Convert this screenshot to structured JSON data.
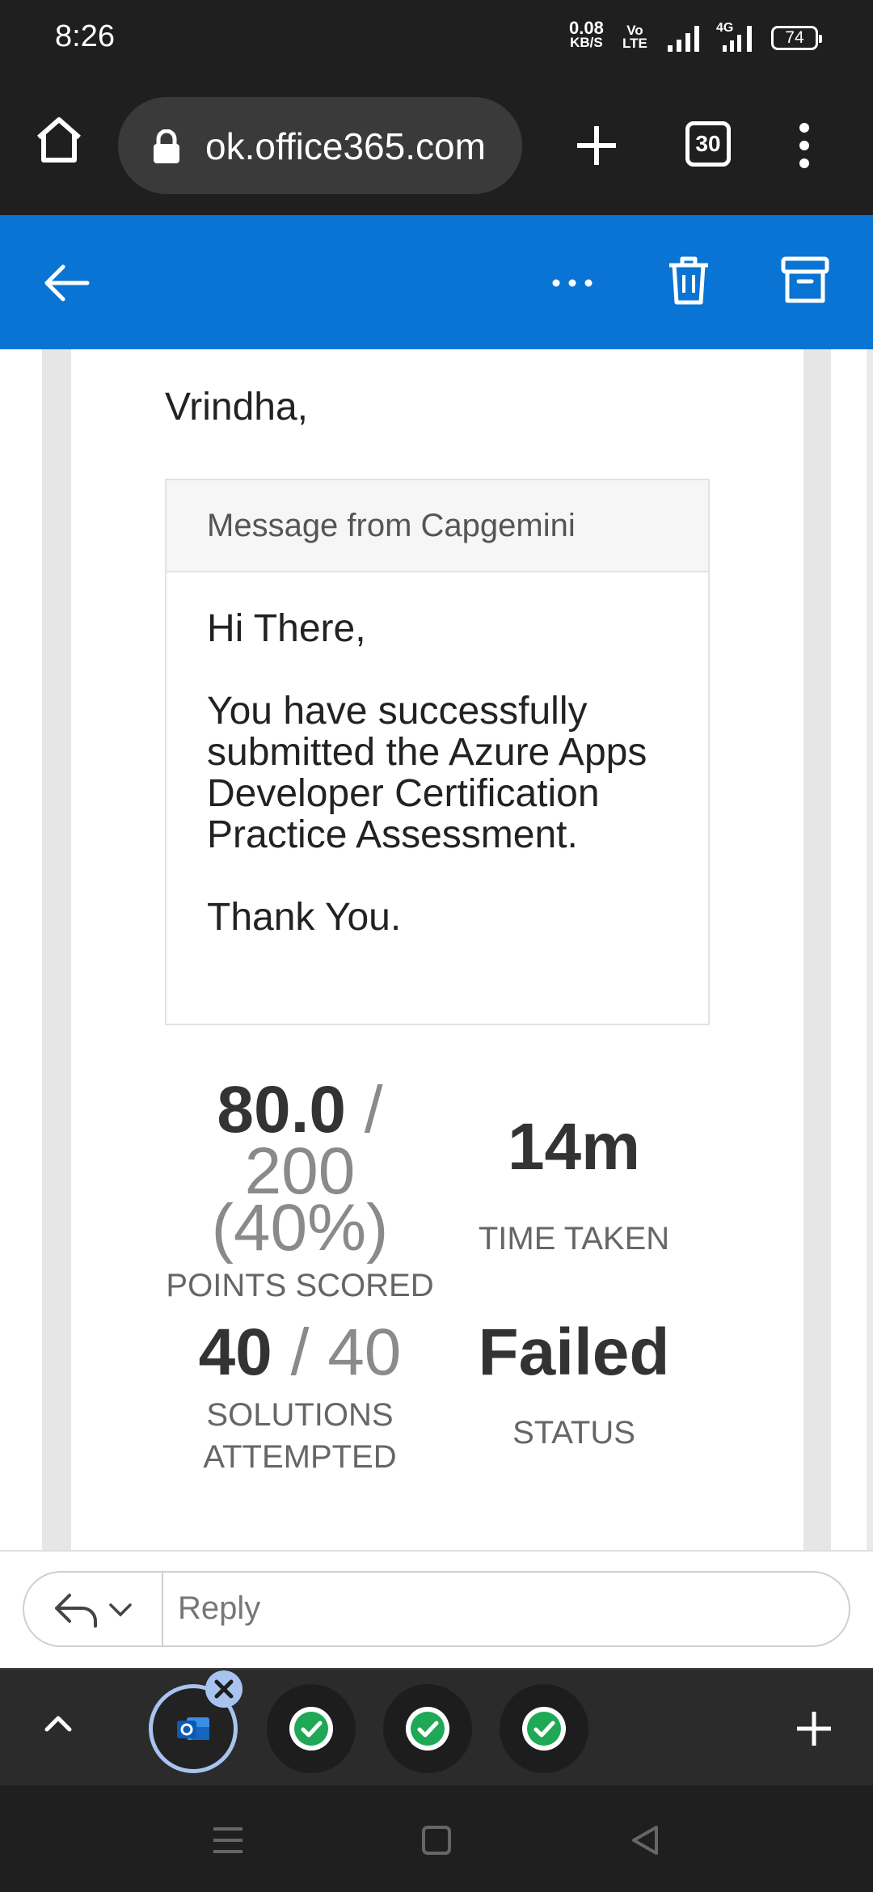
{
  "status_bar": {
    "time": "8:26",
    "net_speed_value": "0.08",
    "net_speed_unit": "KB/S",
    "volte_top": "Vo",
    "volte_bottom": "LTE",
    "network_type": "4G",
    "battery": "74"
  },
  "browser": {
    "url": "ok.office365.com",
    "tab_count": "30",
    "icons": [
      "home-icon",
      "lock-icon",
      "plus-icon",
      "tabs-icon",
      "kebab-menu-icon"
    ]
  },
  "app_bar": {
    "color": "#0a74d4",
    "icons": [
      "back-arrow-icon",
      "more-horizontal-icon",
      "trash-icon",
      "archive-icon"
    ]
  },
  "email": {
    "greeting": "Vrindha,",
    "message_header": "Message from Capgemini",
    "body": {
      "line1": "Hi There,",
      "line2": "You have successfully submitted the Azure Apps Developer Certification Practice Assessment.",
      "line3": "Thank You."
    },
    "stats": {
      "points_scored": "80.0",
      "points_separator": "/",
      "points_total": "200",
      "points_percent": "(40%)",
      "points_label": "POINTS SCORED",
      "time_taken": "14m",
      "time_label": "TIME TAKEN",
      "solutions_attempted": "40",
      "solutions_separator": "/",
      "solutions_total": "40",
      "solutions_label": "SOLUTIONS ATTEMPTED",
      "status": "Failed",
      "status_label": "STATUS"
    }
  },
  "reply_bar": {
    "placeholder": "Reply"
  },
  "tab_strip": {
    "active_tab_icon": "outlook-icon",
    "other_tabs": [
      "check-icon",
      "check-icon",
      "check-icon"
    ],
    "accent": "#a8c3f0",
    "check_color": "#1fa855"
  },
  "system_nav": {
    "icons": [
      "recents-icon",
      "home-square-icon",
      "back-triangle-icon"
    ]
  }
}
